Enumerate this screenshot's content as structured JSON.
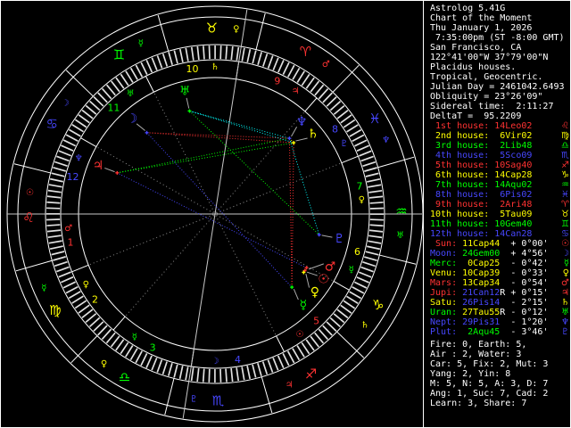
{
  "app": {
    "title": "Astrolog 5.41G"
  },
  "panel": {
    "header_lines": [
      "Astrolog 5.41G",
      "Chart of the Moment",
      "Thu January 1, 2026",
      " 7:35:00pm (ST -8:00 GMT)",
      "San Francisco, CA",
      "122°41'00\"W 37°79'00\"N",
      "Placidus houses.",
      "Tropical, Geocentric.",
      "Julian Day = 2461042.6493",
      "Obliquity = 23°26'09\"",
      "Sidereal time:  2:11:27",
      "DeltaT =  95.2209"
    ],
    "stats_lines": [
      "Fire: 0, Earth: 5,",
      "Air : 2, Water: 3",
      "Car: 5, Fix: 2, Mut: 3",
      "Yang: 2, Yin: 8",
      "M: 5, N: 5, A: 3, D: 7",
      "Ang: 1, Suc: 7, Cad: 2",
      "Learn: 3, Share: 7"
    ]
  },
  "palette": {
    "red": "#ff3232",
    "yellow": "#ffff00",
    "green": "#00ff00",
    "blue": "#4747ff",
    "cyan": "#00ffff",
    "white": "#ffffff",
    "gray": "#aaaaaa",
    "dim": "#8c8c8c",
    "hatch": "#e0e0e0",
    "axis": "#c8c8c8"
  },
  "element_colors": {
    "fire": "red",
    "earth": "yellow",
    "air": "green",
    "water": "blue"
  },
  "aspect_colors": {
    "conjunction": "yellow",
    "opposition": "blue",
    "square": "red",
    "trine": "green",
    "sextile": "cyan"
  },
  "wheel": {
    "ascendant": 134.03,
    "mc": 35.15,
    "signs": [
      {
        "name": "Aries",
        "glyph": "♈",
        "element": "fire",
        "ruler": "Mars"
      },
      {
        "name": "Taurus",
        "glyph": "♉",
        "element": "earth",
        "ruler": "Venu"
      },
      {
        "name": "Gemini",
        "glyph": "♊",
        "element": "air",
        "ruler": "Merc"
      },
      {
        "name": "Cancer",
        "glyph": "♋",
        "element": "water",
        "ruler": "Moon"
      },
      {
        "name": "Leo",
        "glyph": "♌",
        "element": "fire",
        "ruler": "Sun"
      },
      {
        "name": "Virgo",
        "glyph": "♍",
        "element": "earth",
        "ruler": "Merc"
      },
      {
        "name": "Libra",
        "glyph": "♎",
        "element": "air",
        "ruler": "Venu"
      },
      {
        "name": "Scorpio",
        "glyph": "♏",
        "element": "water",
        "ruler": "Plut"
      },
      {
        "name": "Sagittarius",
        "glyph": "♐",
        "element": "fire",
        "ruler": "Jupi"
      },
      {
        "name": "Capricorn",
        "glyph": "♑",
        "element": "earth",
        "ruler": "Satu"
      },
      {
        "name": "Aquarius",
        "glyph": "♒",
        "element": "air",
        "ruler": "Uran"
      },
      {
        "name": "Pisces",
        "glyph": "♓",
        "element": "water",
        "ruler": "Nept"
      }
    ],
    "houses": [
      {
        "ord": "1st",
        "value": "14Leo02",
        "cusp": 134.03,
        "sign_glyph": "♌",
        "element": "fire"
      },
      {
        "ord": "2nd",
        "value": " 6Vir02",
        "cusp": 156.03,
        "sign_glyph": "♍",
        "element": "earth"
      },
      {
        "ord": "3rd",
        "value": " 2Lib48",
        "cusp": 182.8,
        "sign_glyph": "♎",
        "element": "air"
      },
      {
        "ord": "4th",
        "value": " 5Sco09",
        "cusp": 215.15,
        "sign_glyph": "♏",
        "element": "water"
      },
      {
        "ord": "5th",
        "value": "10Sag40",
        "cusp": 250.67,
        "sign_glyph": "♐",
        "element": "fire"
      },
      {
        "ord": "6th",
        "value": "14Cap28",
        "cusp": 284.47,
        "sign_glyph": "♑",
        "element": "earth"
      },
      {
        "ord": "7th",
        "value": "14Aqu02",
        "cusp": 314.03,
        "sign_glyph": "♒",
        "element": "air"
      },
      {
        "ord": "8th",
        "value": " 6Pis02",
        "cusp": 336.03,
        "sign_glyph": "♓",
        "element": "water"
      },
      {
        "ord": "9th",
        "value": " 2Ari48",
        "cusp": 2.8,
        "sign_glyph": "♈",
        "element": "fire"
      },
      {
        "ord": "10th",
        "value": " 5Tau09",
        "cusp": 35.15,
        "sign_glyph": "♉",
        "element": "earth"
      },
      {
        "ord": "11th",
        "value": "10Gem40",
        "cusp": 70.67,
        "sign_glyph": "♊",
        "element": "air"
      },
      {
        "ord": "12th",
        "value": "14Can28",
        "cusp": 104.47,
        "sign_glyph": "♋",
        "element": "water"
      }
    ],
    "planets": [
      {
        "name": "Sun",
        "glyph": "☉",
        "color": "red",
        "lon": 281.73,
        "display_lon": 283.0,
        "retro": false,
        "value": "11Cap44",
        "value_element": "earth",
        "lat": "+ 0°00'"
      },
      {
        "name": "Moon",
        "glyph": "☽",
        "color": "blue",
        "lon": 84.0,
        "display_lon": 85.0,
        "retro": false,
        "value": "24Gem00",
        "value_element": "air",
        "lat": "+ 4°56'"
      },
      {
        "name": "Merc",
        "glyph": "☿",
        "color": "green",
        "lon": 270.42,
        "display_lon": 268.2,
        "retro": false,
        "value": " 0Cap25",
        "value_element": "earth",
        "lat": "- 0°42'"
      },
      {
        "name": "Venu",
        "glyph": "♀",
        "color": "yellow",
        "lon": 280.65,
        "display_lon": 276.0,
        "retro": false,
        "value": "10Cap39",
        "value_element": "earth",
        "lat": "- 0°33'"
      },
      {
        "name": "Mars",
        "glyph": "♂",
        "color": "red",
        "lon": 283.57,
        "display_lon": 289.4,
        "retro": false,
        "value": "13Cap34",
        "value_element": "earth",
        "lat": "- 0°54'"
      },
      {
        "name": "Jupi",
        "glyph": "♃",
        "color": "red",
        "lon": 111.2,
        "display_lon": 111.4,
        "retro": true,
        "value": "21Can12",
        "value_element": "water",
        "lat": "+ 0°15'"
      },
      {
        "name": "Satu",
        "glyph": "♄",
        "color": "yellow",
        "lon": 356.23,
        "display_lon": 353.4,
        "retro": false,
        "value": "26Pis14",
        "value_element": "water",
        "lat": "- 2°15'"
      },
      {
        "name": "Uran",
        "glyph": "♅",
        "color": "green",
        "lon": 57.92,
        "display_lon": 57.8,
        "retro": true,
        "value": "27Tau55",
        "value_element": "earth",
        "lat": "- 0°12'"
      },
      {
        "name": "Nept",
        "glyph": "♆",
        "color": "blue",
        "lon": 359.52,
        "display_lon": 0.9,
        "retro": false,
        "value": "29Pis31",
        "value_element": "water",
        "lat": "- 1°20'"
      },
      {
        "name": "Plut",
        "glyph": "♇",
        "color": "blue",
        "lon": 302.75,
        "display_lon": 302.8,
        "retro": false,
        "value": " 2Aqu45",
        "value_element": "air",
        "lat": "- 3°46'"
      }
    ],
    "aspects": [
      {
        "a": "Sun",
        "b": "Venu",
        "type": "conjunction"
      },
      {
        "a": "Sun",
        "b": "Mars",
        "type": "conjunction"
      },
      {
        "a": "Venu",
        "b": "Mars",
        "type": "conjunction"
      },
      {
        "a": "Satu",
        "b": "Nept",
        "type": "conjunction"
      },
      {
        "a": "Moon",
        "b": "Merc",
        "type": "opposition"
      },
      {
        "a": "Mars",
        "b": "Jupi",
        "type": "opposition"
      },
      {
        "a": "Moon",
        "b": "Satu",
        "type": "square"
      },
      {
        "a": "Moon",
        "b": "Nept",
        "type": "square"
      },
      {
        "a": "Merc",
        "b": "Satu",
        "type": "square"
      },
      {
        "a": "Merc",
        "b": "Nept",
        "type": "square"
      },
      {
        "a": "Jupi",
        "b": "Satu",
        "type": "trine"
      },
      {
        "a": "Jupi",
        "b": "Nept",
        "type": "trine"
      },
      {
        "a": "Uran",
        "b": "Plut",
        "type": "trine"
      },
      {
        "a": "Satu",
        "b": "Uran",
        "type": "sextile"
      },
      {
        "a": "Uran",
        "b": "Nept",
        "type": "sextile"
      },
      {
        "a": "Nept",
        "b": "Plut",
        "type": "sextile"
      }
    ]
  }
}
